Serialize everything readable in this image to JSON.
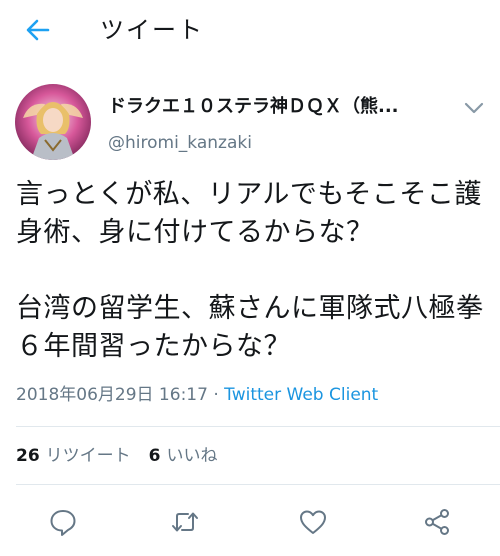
{
  "header": {
    "title": "ツイート",
    "back_icon": "arrow-left-icon",
    "accent_color": "#1da1f2"
  },
  "tweet": {
    "author": {
      "display_name": "ドラクエ１０ステラ神ＤＱＸ（熊...",
      "handle": "@hiromi_kanzaki"
    },
    "text_paragraphs": [
      "言っとくが私、リアルでもそこそこ護身術、身に付けてるからな？",
      "台湾の留学生、蘇さんに軍隊式八極拳６年間習ったからな？"
    ],
    "timestamp": "2018年06月29日 16:17",
    "separator": " · ",
    "source": "Twitter Web Client"
  },
  "stats": {
    "retweets_count": "26",
    "retweets_label": "リツイート",
    "likes_count": "6",
    "likes_label": "いいね"
  },
  "actions": [
    {
      "name": "reply",
      "icon": "reply-bubble-icon"
    },
    {
      "name": "retweet",
      "icon": "retweet-arrows-icon"
    },
    {
      "name": "like",
      "icon": "heart-icon"
    },
    {
      "name": "share",
      "icon": "share-nodes-icon"
    }
  ]
}
